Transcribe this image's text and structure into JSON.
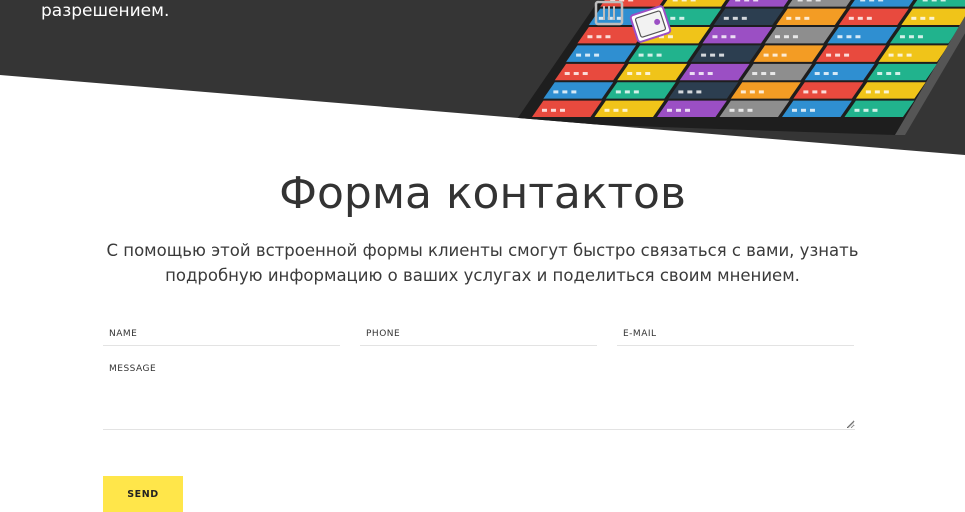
{
  "hero": {
    "text_line": "разрешением."
  },
  "section": {
    "title": "Форма контактов",
    "description": "С помощью этой встроенной формы клиенты смогут быстро связаться с вами, узнать подробную информацию о ваших услугах и поделиться своим мнением."
  },
  "form": {
    "name_placeholder": "NAME",
    "phone_placeholder": "PHONE",
    "email_placeholder": "E-MAIL",
    "message_placeholder": "MESSAGE",
    "send_label": "SEND"
  },
  "colors": {
    "dark_band": "#353535",
    "accent_yellow": "#ffe64a",
    "tiles": [
      "#e84a3e",
      "#21b38d",
      "#9b4fc4",
      "#f39c24",
      "#2f8fd1",
      "#f0c419",
      "#2c3e50",
      "#8e8e8e"
    ]
  }
}
